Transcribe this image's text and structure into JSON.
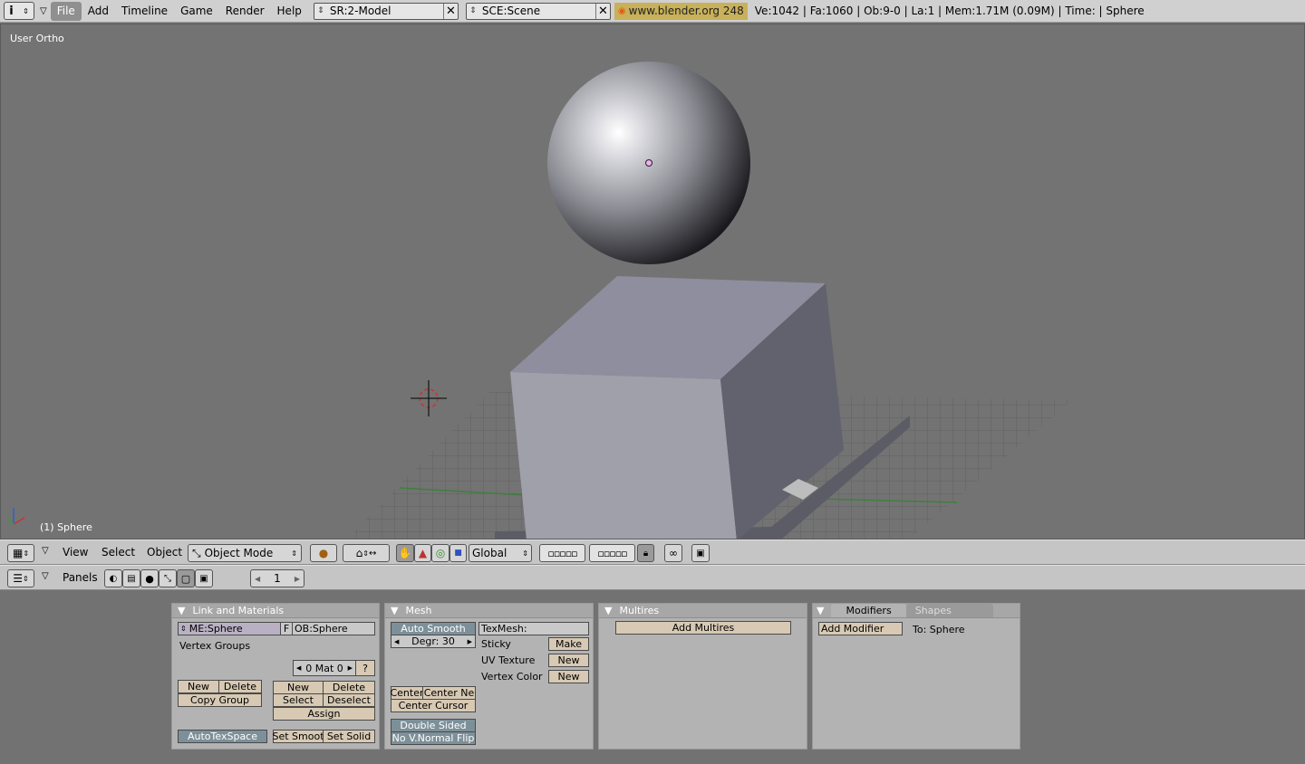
{
  "topbar": {
    "menus": [
      "File",
      "Add",
      "Timeline",
      "Game",
      "Render",
      "Help"
    ],
    "screen": "SR:2-Model",
    "scene": "SCE:Scene",
    "url": "www.blender.org 248",
    "stats": "Ve:1042 | Fa:1060 | Ob:9-0 | La:1  | Mem:1.71M (0.09M)  | Time: | Sphere"
  },
  "viewport": {
    "view_label": "User Ortho",
    "object_label": "(1) Sphere"
  },
  "view3d_header": {
    "menus": [
      "View",
      "Select",
      "Object"
    ],
    "mode": "Object Mode",
    "orientation": "Global"
  },
  "buttons_header": {
    "label": "Panels",
    "frame": "1"
  },
  "panels": {
    "link": {
      "title": "Link and Materials",
      "mesh_name": "ME:Sphere",
      "f_label": "F",
      "ob_name": "OB:Sphere",
      "vertex_groups": "Vertex Groups",
      "mat": "0 Mat 0",
      "q": "?",
      "vg_new": "New",
      "vg_delete": "Delete",
      "copy_group": "Copy Group",
      "mat_new": "New",
      "mat_delete": "Delete",
      "select": "Select",
      "deselect": "Deselect",
      "assign": "Assign",
      "autotex": "AutoTexSpace",
      "set_smooth": "Set Smoot",
      "set_solid": "Set Solid"
    },
    "mesh": {
      "title": "Mesh",
      "auto_smooth": "Auto Smooth",
      "degr": "Degr: 30",
      "texmesh": "TexMesh:",
      "sticky": "Sticky",
      "make": "Make",
      "uv_texture": "UV Texture",
      "uv_new": "New",
      "vertex_color": "Vertex Color",
      "vc_new": "New",
      "center": "Center",
      "center_new": "Center Ne",
      "center_cursor": "Center Cursor",
      "double_sided": "Double Sided",
      "no_vnormal_flip": "No V.Normal Flip"
    },
    "multires": {
      "title": "Multires",
      "add": "Add Multires"
    },
    "modifiers": {
      "tab_modifiers": "Modifiers",
      "tab_shapes": "Shapes",
      "add": "Add Modifier",
      "to": "To: Sphere"
    }
  }
}
